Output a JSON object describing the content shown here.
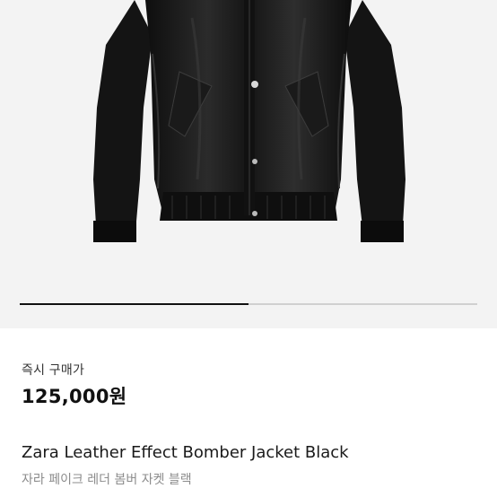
{
  "product": {
    "image_alt_icon": "jacket-photo",
    "carousel_progress": 0.5,
    "price_label": "즉시 구매가",
    "price": "125,000원",
    "title": "Zara Leather Effect Bomber Jacket Black",
    "subtitle": "자라 페이크 레더 봄버 자켓 블랙"
  },
  "colors": {
    "background": "#ffffff",
    "photo_background": "#f3f3f3",
    "leather": "#1c1c1c",
    "indicator_track": "#d0d0d0",
    "indicator_fill": "#111111",
    "subtitle_text": "#8c8c8c"
  }
}
